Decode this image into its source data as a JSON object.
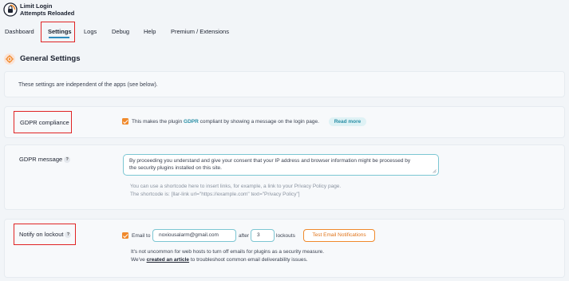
{
  "brand": {
    "line1": "Limit Login",
    "line2": "Attempts Reloaded"
  },
  "nav": {
    "items": [
      {
        "label": "Dashboard"
      },
      {
        "label": "Settings"
      },
      {
        "label": "Logs"
      },
      {
        "label": "Debug"
      },
      {
        "label": "Help"
      },
      {
        "label": "Premium / Extensions"
      }
    ],
    "active": "Settings"
  },
  "section": {
    "title": "General Settings"
  },
  "intro": {
    "text": "These settings are independent of the apps (see below)."
  },
  "gdpr": {
    "label": "GDPR compliance",
    "checkbox_checked": true,
    "text_before": "This makes the plugin",
    "link": "GDPR",
    "text_after": "compliant by showing a message on the login page.",
    "read_more": "Read more"
  },
  "gdpr_message": {
    "label": "GDPR message",
    "help": "?",
    "value_line1": "By proceeding you understand and give your consent that your IP address and browser information might be processed by",
    "value_line2": "the security plugins installed on this site.",
    "hint_line1": "You can use a shortcode here to insert links, for example, a link to your Privacy Policy page.",
    "hint_line2": "The shortcode is: [llar-link url=\"https://example.com\" text=\"Privacy Policy\"]"
  },
  "notify": {
    "label": "Notify on lockout",
    "help": "?",
    "checkbox_checked": true,
    "email_to_label": "Email to",
    "email_value": "noxiousalarm@gmail.com",
    "after_label": "after",
    "after_value": "3",
    "lockouts_label": "lockouts",
    "test_button": "Test Email Notifications",
    "note_line1": "It's not uncommon for web hosts to turn off emails for plugins as a security measure.",
    "note_prefix": "We've",
    "note_link": "created an article",
    "note_suffix": "to troubleshoot common email deliverability issues."
  },
  "colors": {
    "accent": "#f08a2c",
    "teal": "#2a8fa6",
    "highlight": "#e02424"
  }
}
